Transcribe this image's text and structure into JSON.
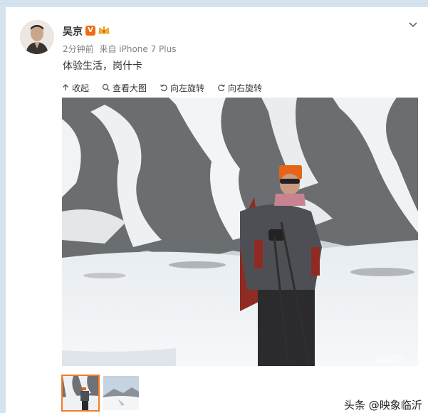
{
  "post": {
    "author": "吴京",
    "verified_badge": "V",
    "meta_time": "2分钟前",
    "meta_source": "来自 iPhone 7 Plus",
    "text": "体验生活，岗什卡"
  },
  "toolbar": {
    "collapse_label": "收起",
    "view_large_label": "查看大图",
    "rotate_left_label": "向左旋转",
    "rotate_right_label": "向右旋转"
  },
  "photo": {
    "watermark": "@吴京"
  },
  "thumbnails": [
    {
      "label": "thumbnail-1",
      "selected": true
    },
    {
      "label": "thumbnail-2",
      "selected": false
    }
  ],
  "source_watermark": "头条 @映象临沂",
  "colors": {
    "accent": "#f57c26",
    "background": "#d5e3ef",
    "card": "#ffffff"
  }
}
